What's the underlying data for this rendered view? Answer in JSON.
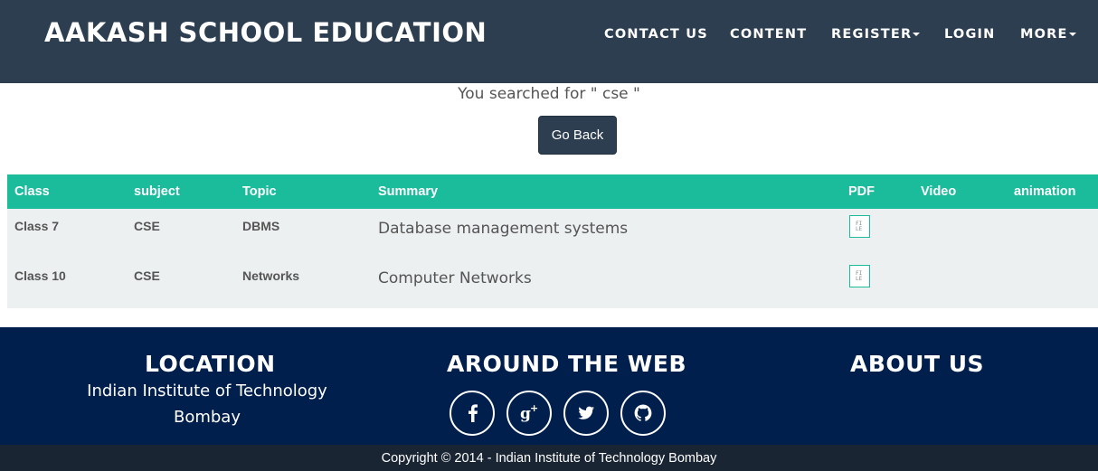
{
  "navbar": {
    "brand": "AAKASH SCHOOL EDUCATION",
    "items": [
      {
        "label": "CONTACT US",
        "has_caret": false
      },
      {
        "label": "CONTENT",
        "has_caret": false
      },
      {
        "label": "REGISTER",
        "has_caret": true
      },
      {
        "label": "LOGIN",
        "has_caret": false
      },
      {
        "label": "MORE",
        "has_caret": true
      }
    ]
  },
  "search": {
    "result_text": "You searched for \" cse \"",
    "back_label": "Go Back"
  },
  "table": {
    "headers": [
      "Class",
      "subject",
      "Topic",
      "Summary",
      "PDF",
      "Video",
      "animation"
    ],
    "rows": [
      {
        "class": "Class 7",
        "subject": "CSE",
        "topic": "DBMS",
        "summary": "Database management systems",
        "pdf_icon": "pdf-file-icon"
      },
      {
        "class": "Class 10",
        "subject": "CSE",
        "topic": "Networks",
        "summary": "Computer Networks",
        "pdf_icon": "pdf-file-icon"
      }
    ]
  },
  "footer": {
    "location_heading": "LOCATION",
    "location_text": "Indian Institute of Technology Bombay",
    "web_heading": "AROUND THE WEB",
    "social_icons": [
      "facebook-icon",
      "google-plus-icon",
      "twitter-icon",
      "github-icon"
    ],
    "about_heading": "ABOUT US",
    "copyright": "Copyright © 2014 - Indian Institute of Technology Bombay"
  },
  "colors": {
    "navbar_bg": "#2c3e50",
    "table_header_bg": "#1abc9c",
    "table_body_bg": "#ecf0f1",
    "footer_bg": "#001f4d",
    "copyright_bg": "#1a2533"
  }
}
